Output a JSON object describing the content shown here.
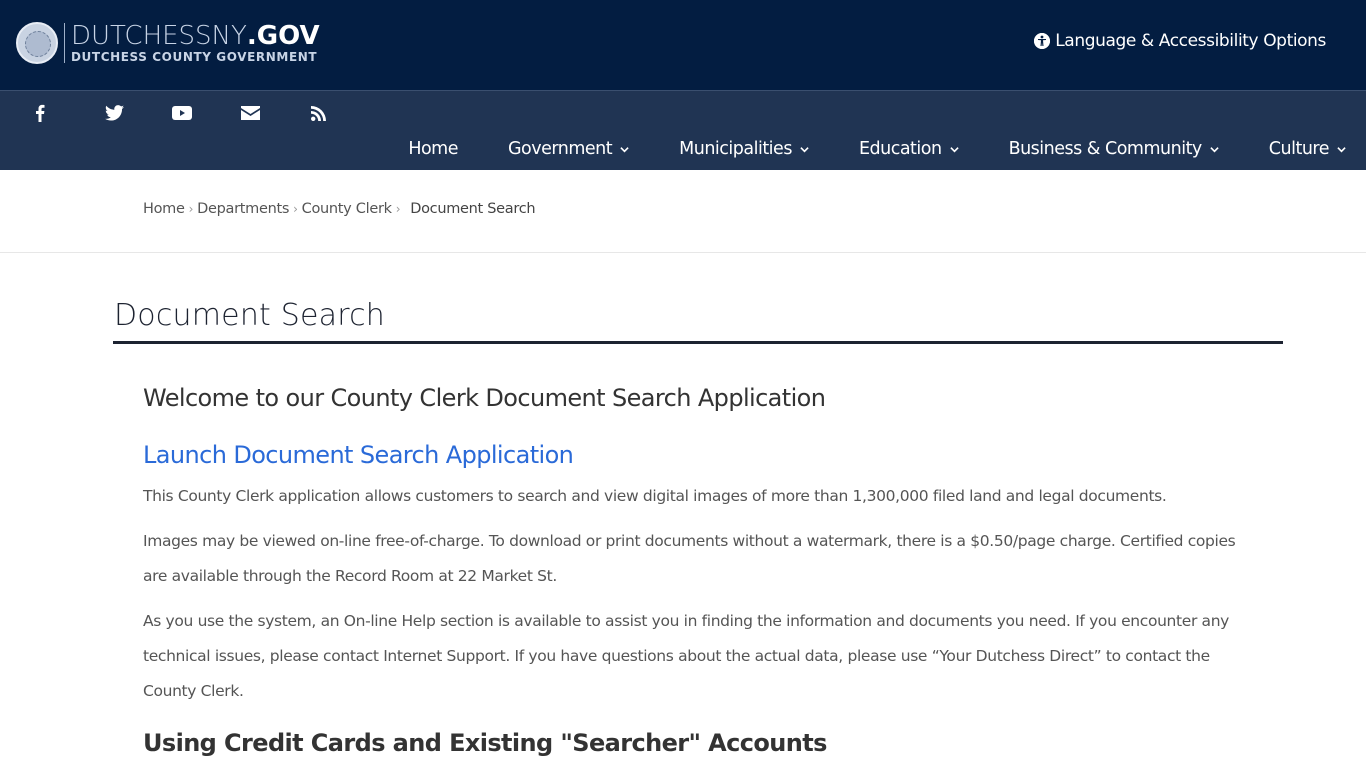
{
  "header": {
    "logo_main": "DUTCHESSNY",
    "logo_tld": ".GOV",
    "logo_sub": "DUTCHESS COUNTY GOVERNMENT",
    "accessibility_label": "Language & Accessibility Options",
    "accessibility_icon": "accessibility-icon"
  },
  "social": [
    {
      "name": "facebook-icon"
    },
    {
      "name": "twitter-icon"
    },
    {
      "name": "youtube-icon"
    },
    {
      "name": "email-icon"
    },
    {
      "name": "rss-icon"
    }
  ],
  "nav": {
    "items": [
      {
        "label": "Home",
        "has_dropdown": false
      },
      {
        "label": "Government",
        "has_dropdown": true
      },
      {
        "label": "Municipalities",
        "has_dropdown": true
      },
      {
        "label": "Education",
        "has_dropdown": true
      },
      {
        "label": "Business & Community",
        "has_dropdown": true
      },
      {
        "label": "Culture",
        "has_dropdown": true
      }
    ]
  },
  "breadcrumb": {
    "items": [
      "Home",
      "Departments",
      "County Clerk"
    ],
    "current": "Document Search",
    "separator": "›"
  },
  "page": {
    "title": "Document Search",
    "welcome_heading": "Welcome to our County Clerk Document Search Application",
    "launch_link": "Launch Document Search Application",
    "paragraphs": [
      "This County Clerk application allows customers to search and view digital images of more than 1,300,000 filed land and legal documents.",
      "Images may be viewed on-line free-of-charge. To download or print documents without a watermark, there is a $0.50/page charge. Certified copies are available through the Record Room at 22 Market St.",
      "As you use the system, an On-line Help section is available to assist you in finding the information and documents you need. If you encounter any technical issues, please contact Internet Support. If you have questions about the actual data, please use “Your Dutchess Direct” to contact the County Clerk."
    ],
    "credit_heading": "Using Credit Cards and Existing \"Searcher\" Accounts"
  },
  "colors": {
    "header_bg": "#031d41",
    "nav_bg": "#203453",
    "link": "#2a6ad8",
    "title_rule": "#1d2331"
  }
}
